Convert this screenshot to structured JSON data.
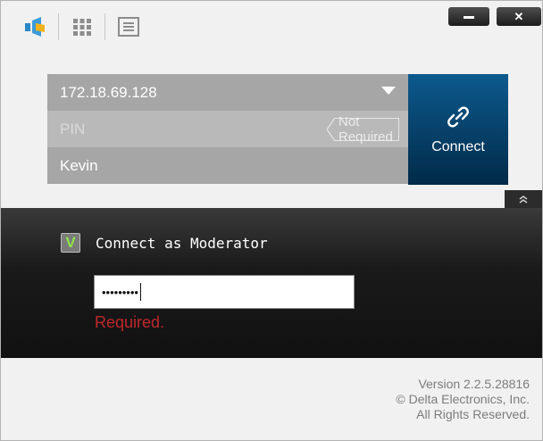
{
  "toolbar": {
    "icons": [
      "app-logo-icon",
      "grid-icon",
      "menu-icon"
    ],
    "minimize_glyph": "–",
    "close_glyph": "✕"
  },
  "connection": {
    "ip_value": "172.18.69.128",
    "pin_placeholder": "PIN",
    "pin_status": "Not Required",
    "name_value": "Kevin",
    "connect_label": "Connect"
  },
  "moderator": {
    "checked": true,
    "check_glyph": "V",
    "label": "Connect as Moderator",
    "password_mask": "•••••••••",
    "error_text": "Required."
  },
  "footer": {
    "version": "Version 2.2.5.28816",
    "copyright": "© Delta Electronics, Inc.",
    "rights": "All Rights Reserved."
  },
  "colors": {
    "connect_button": "#01365c",
    "error": "#c0272d",
    "check": "#8fe34a"
  }
}
